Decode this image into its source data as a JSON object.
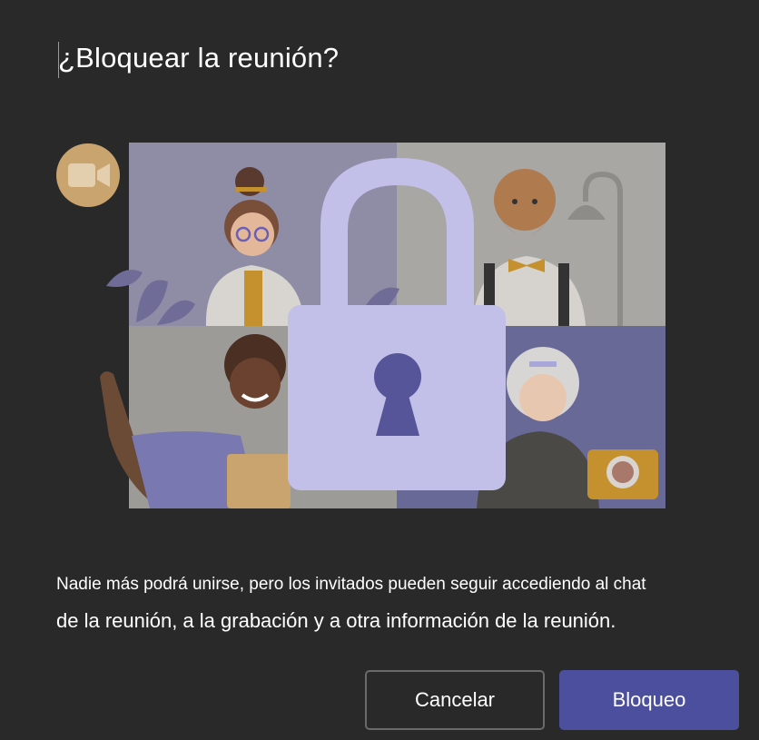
{
  "dialog": {
    "title": "¿Bloquear la reunión?",
    "description_line1": "Nadie más podrá unirse, pero los invitados pueden seguir accediendo al chat",
    "description_line2": "de la reunión, a la grabación y a otra información de la reunión.",
    "cancel_label": "Cancelar",
    "lock_label": "Bloqueo"
  },
  "colors": {
    "background": "#292929",
    "primary_button": "#4b4f9e",
    "padlock": "#c2bfe8",
    "keyhole": "#56559a",
    "video_badge": "#c9a46e"
  },
  "icons": {
    "video_badge": "video-camera-icon",
    "padlock": "padlock-icon"
  }
}
